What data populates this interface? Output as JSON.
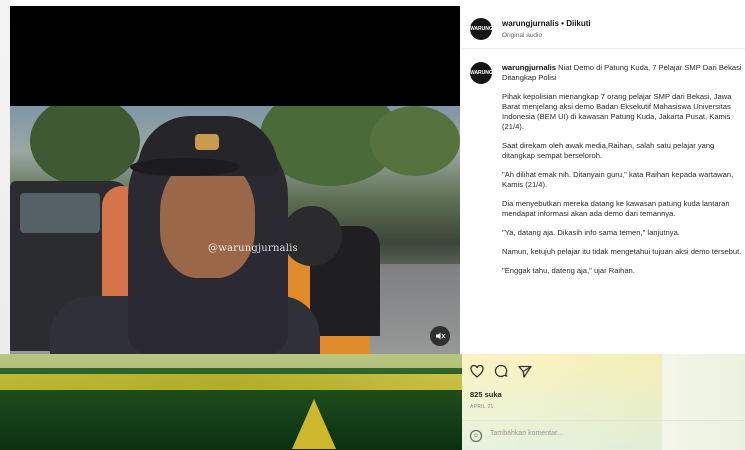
{
  "header": {
    "username": "warungjurnalis",
    "separator": "•",
    "follow_status": "Diikuti",
    "audio": "Original audio",
    "avatar_text": "WARUNG"
  },
  "video": {
    "watermark": "@warungjurnalis",
    "mute_icon": "speaker-muted-icon"
  },
  "caption": {
    "username": "warungjurnalis",
    "paragraphs": [
      "Niat Demo di Patung Kuda, 7 Pelajar SMP Dari Bekasi Ditangkap Polisi",
      "Pihak kepolisian menangkap 7 orang pelajar SMP dari Bekasi, Jawa Barat menjelang aksi demo Badan Eksekutif Mahasiswa Universitas Indonesia (BEM UI) di kawasan Patung Kuda, Jakarta Pusat, Kamis (21/4).",
      "Saat direkam oleh awak media,Raihan, salah satu pelajar yang ditangkap sempat berseloroh.",
      "\"Ah dilihat emak nih. Ditanyain guru,\" kata Raihan kepada wartawan, Kamis (21/4).",
      "Dia menyebutkan mereka datang ke kawasan patung kuda lantaran mendapat informasi akan ada demo dari temannya.",
      "\"Ya, datang aja. Dikasih info sama temen,\" lanjutnya.",
      "Namun, ketujuh pelajar itu tidak mengetahui tujuan aksi demo tersebut.",
      "\"Enggak tahu, dateng aja,\" ujar Raihan."
    ]
  },
  "actions": {
    "like_icon": "heart-icon",
    "comment_icon": "comment-icon",
    "share_icon": "share-icon",
    "likes": "825 suka",
    "date": "APRIL 21"
  },
  "comment": {
    "placeholder": "Tambahkan komentar...",
    "emoji_icon": "emoji-icon"
  },
  "colors": {
    "text": "#111111",
    "muted": "#666666",
    "overlay_green": "#1f4f1e",
    "overlay_yellow": "#d7c83a"
  }
}
